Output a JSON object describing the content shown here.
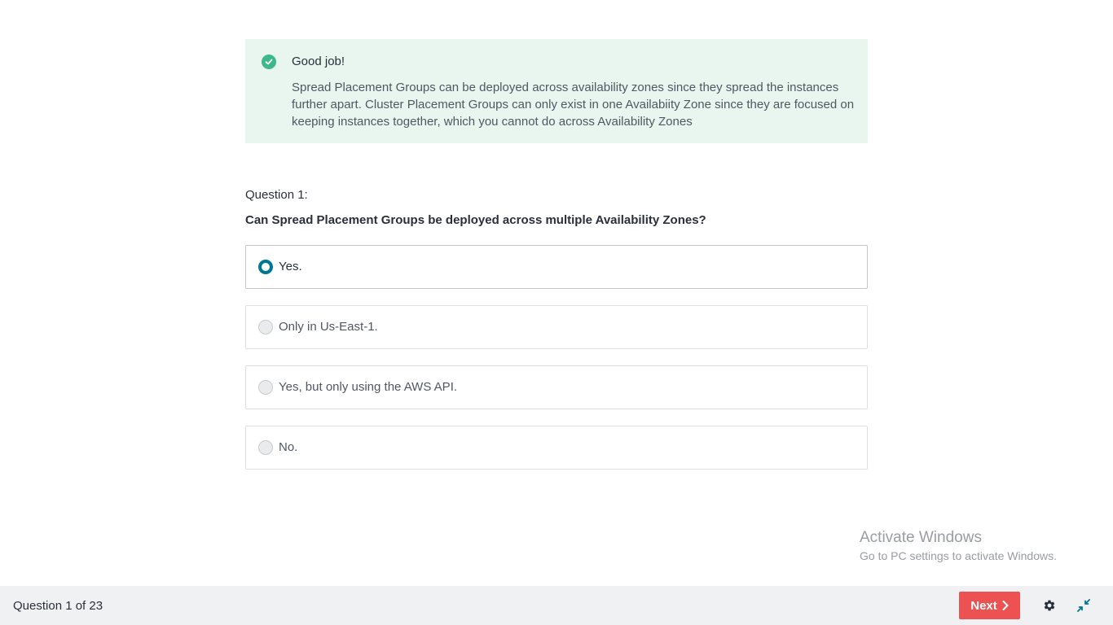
{
  "feedback": {
    "title": "Good job!",
    "explanation": "Spread Placement Groups can be deployed across availability zones since they spread the instances further apart. Cluster Placement Groups can only exist in one Availabiity Zone since they are focused on keeping instances together, which you cannot do across Availability Zones",
    "status_color": "#3db88b",
    "background_color": "#e8f6ef",
    "icon": "check-circle-icon"
  },
  "question": {
    "label": "Question 1:",
    "text": "Can Spread Placement Groups be deployed across multiple Availability Zones?"
  },
  "options": [
    {
      "label": "Yes.",
      "selected": true
    },
    {
      "label": "Only in Us-East-1.",
      "selected": false
    },
    {
      "label": "Yes, but only using the AWS API.",
      "selected": false
    },
    {
      "label": "No.",
      "selected": false
    }
  ],
  "watermark": {
    "title": "Activate Windows",
    "subtitle": "Go to PC settings to activate Windows."
  },
  "footer": {
    "counter": "Question 1 of 23",
    "next_label": "Next",
    "next_color": "#ec5252",
    "icons": [
      "chevron-right-icon",
      "gear-icon",
      "collapse-icon"
    ]
  },
  "accent_color": "#007791"
}
